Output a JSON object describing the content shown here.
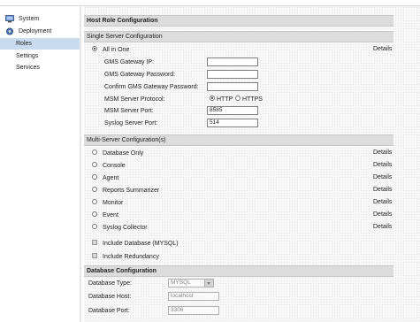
{
  "sidebar": {
    "items": [
      {
        "label": "System",
        "icon": "monitor-icon"
      },
      {
        "label": "Deployment",
        "icon": "gear-icon"
      },
      {
        "label": "Roles",
        "icon": ""
      },
      {
        "label": "Settings",
        "icon": ""
      },
      {
        "label": "Services",
        "icon": ""
      }
    ],
    "selected": "Roles",
    "selected_color": "#c8dbef"
  },
  "main": {
    "title": "Host Role Configuration",
    "single_server": {
      "header": "Single Server Configuration",
      "all_in_one_label": "All in One",
      "details_label": "Details",
      "fields": {
        "gms_gateway_ip": {
          "label": "GMS Gateway IP:",
          "value": ""
        },
        "gms_gateway_password": {
          "label": "GMS Gateway Password:",
          "value": ""
        },
        "confirm_password": {
          "label": "Confirm GMS Gateway Password:",
          "value": ""
        },
        "msm_protocol": {
          "label": "MSM Server Protocol:",
          "options": [
            "HTTP",
            "HTTPS"
          ],
          "selected": "HTTP"
        },
        "msm_port": {
          "label": "MSM Server Port:",
          "value": "8585"
        },
        "syslog_port": {
          "label": "Syslog Server Port:",
          "value": "514"
        }
      }
    },
    "multi_server": {
      "header": "Multi-Server Configuration(s)",
      "details_label": "Details",
      "roles": [
        "Database Only",
        "Console",
        "Agent",
        "Reports Summarizer",
        "Monitor",
        "Event",
        "Syslog Collector"
      ],
      "checkboxes": [
        "Include Database (MYSQL)",
        "Include Redundancy"
      ]
    },
    "database": {
      "header": "Database Configuration",
      "type": {
        "label": "Database Type:",
        "value": "MYSQL"
      },
      "host": {
        "label": "Database Host:",
        "value": "localhost"
      },
      "port": {
        "label": "Database Port:",
        "value": "3306"
      }
    }
  }
}
